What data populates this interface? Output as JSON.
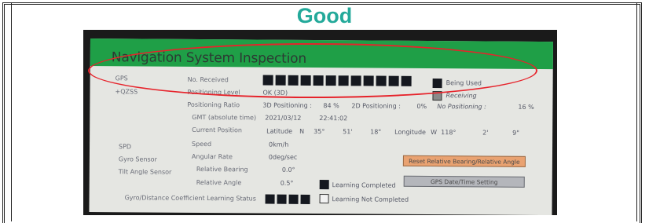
{
  "verdict": "Good",
  "colors": {
    "verdict": "#23a99a",
    "title_bar": "#1f9f47",
    "annotation": "#e6232b"
  },
  "screen": {
    "title": "Navigation System Inspection",
    "left_labels": {
      "gps": "GPS",
      "qzss": "+QZSS",
      "spd": "SPD",
      "gyro": "Gyro Sensor",
      "tilt": "Tilt Angle Sensor",
      "coefficient": "Gyro/Distance Coefficient Learning Status"
    },
    "rows": {
      "no_received": "No. Received",
      "positioning_level": "Positioning Level",
      "positioning_level_value": "OK (3D)",
      "positioning_ratio": "Positioning Ratio",
      "ratio_3d_label": "3D Positioning :",
      "ratio_3d_value": "84 %",
      "ratio_2d_label": "2D Positioning :",
      "ratio_2d_value": "0%",
      "ratio_none_label": "No Positioning :",
      "ratio_none_value": "16 %",
      "gmt_label": "GMT (absolute time)",
      "gmt_date": "2021/03/12",
      "gmt_time": "22:41:02",
      "current_position": "Current Position",
      "latitude_label": "Latitude",
      "lat_dir": "N",
      "lat_deg": "35°",
      "lat_min": "51'",
      "lat_sec": "18\"",
      "longitude_label": "Longitude",
      "lon_dir": "W",
      "lon_deg": "118°",
      "lon_min": "2'",
      "lon_sec": "9\"",
      "speed_label": "Speed",
      "speed_value": "0km/h",
      "angular_rate_label": "Angular Rate",
      "angular_rate_value": "0deg/sec",
      "rel_bearing_label": "Relative Bearing",
      "rel_bearing_value": "0.0°",
      "rel_angle_label": "Relative Angle",
      "rel_angle_value": "0.5°"
    },
    "legend": {
      "being_used": "Being Used",
      "receiving": "Receiving",
      "learning_completed": "Learning Completed",
      "learning_not_completed": "Learning Not Completed"
    },
    "satellites_received": 12,
    "learning_blocks": 4,
    "buttons": {
      "reset": "Reset Relative Bearing/Relative Angle",
      "gps_date": "GPS Date/Time Setting"
    }
  }
}
